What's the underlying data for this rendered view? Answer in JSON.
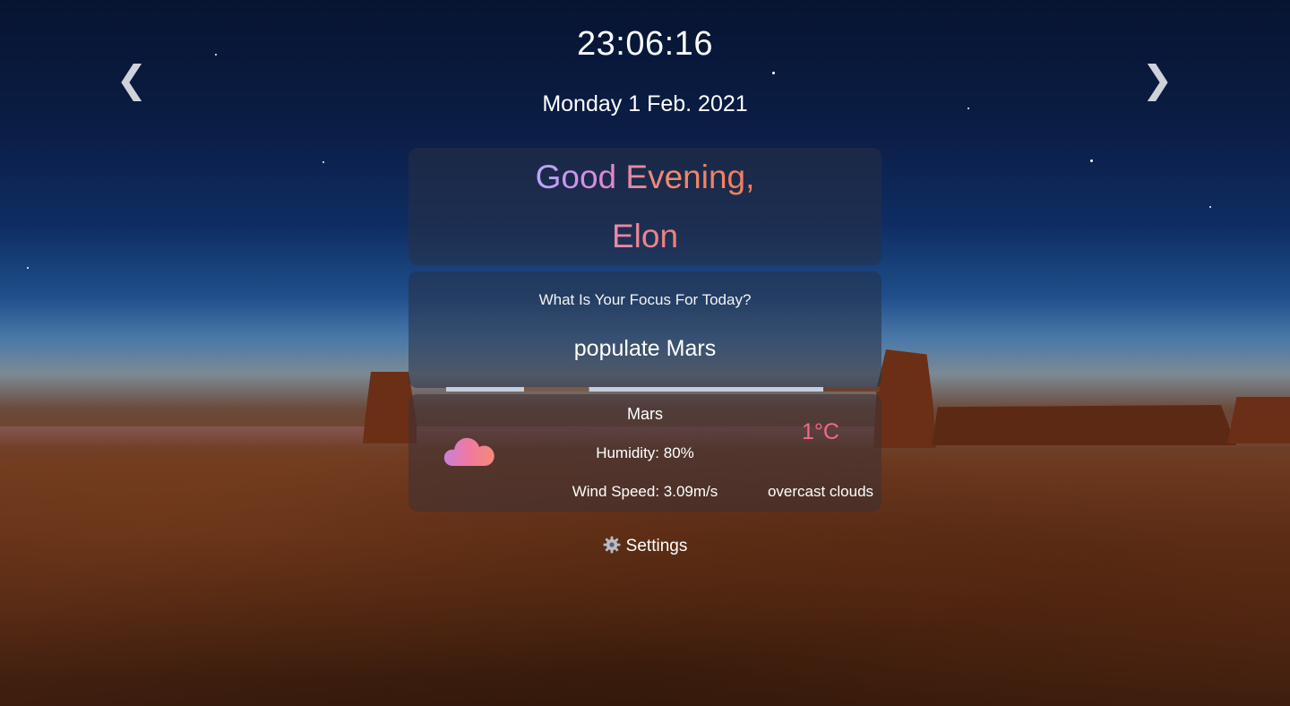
{
  "clock": {
    "time": "23:06:16"
  },
  "date": {
    "text": "Monday 1 Feb. 2021"
  },
  "nav": {
    "prev_glyph": "❮",
    "next_glyph": "❯",
    "prev_icon": "chevron-left-icon",
    "next_icon": "chevron-right-icon"
  },
  "greeting": {
    "line": "Good Evening,",
    "name": "Elon"
  },
  "focus": {
    "question": "What Is Your Focus For Today?",
    "value": "populate Mars"
  },
  "weather": {
    "location": "Mars",
    "humidity": "Humidity: 80%",
    "wind": "Wind Speed: 3.09m/s",
    "temperature": "1°C",
    "description": "overcast clouds",
    "icon": "cloud-icon"
  },
  "settings": {
    "label": "Settings",
    "icon": "gear-icon"
  },
  "colors": {
    "temperature": "#f06a8a",
    "greeting_start": "#b9a6ff",
    "greeting_end": "#f07d5a"
  }
}
